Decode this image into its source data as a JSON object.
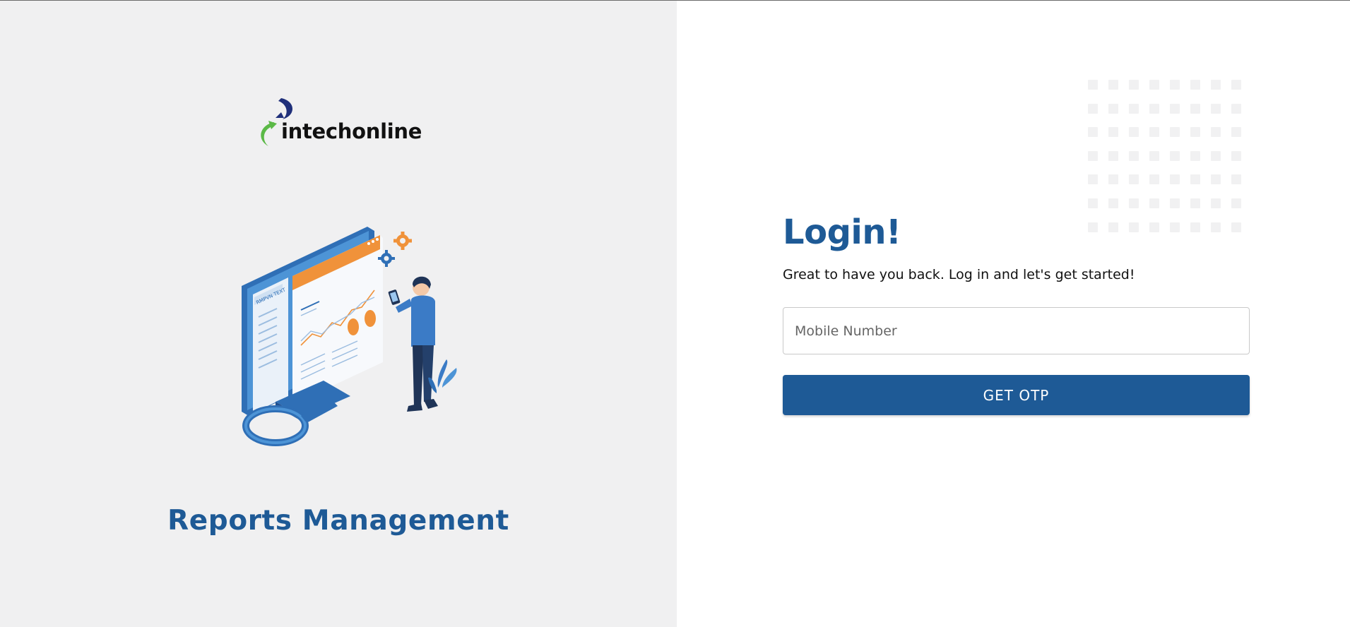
{
  "brand": {
    "name": "intechonline",
    "colors": {
      "primary": "#1e5a96",
      "accent_green": "#5bb947",
      "accent_orange": "#f0923a",
      "left_panel_bg": "#f0f0f1"
    }
  },
  "left_panel": {
    "title": "Reports Management",
    "illustration": "person-with-phone-analyzing-dashboard-monitor"
  },
  "login": {
    "heading": "Login!",
    "subtitle": "Great to have you back. Log in and let's get started!",
    "mobile_field": {
      "placeholder": "Mobile Number",
      "value": ""
    },
    "submit_label": "GET OTP"
  }
}
